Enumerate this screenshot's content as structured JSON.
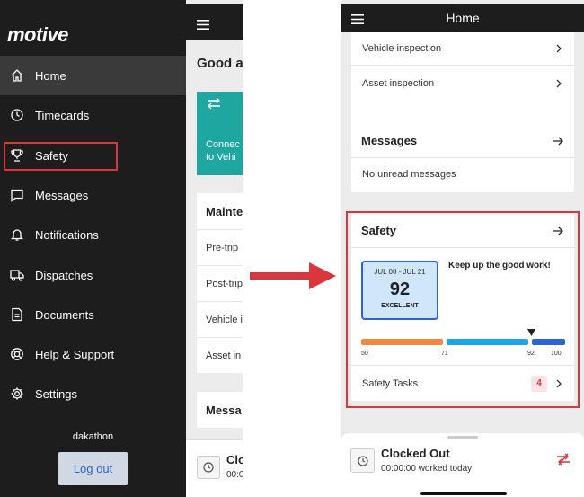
{
  "left": {
    "logo": "motive",
    "nav": [
      {
        "label": "Home",
        "icon": "home-icon"
      },
      {
        "label": "Timecards",
        "icon": "clock-icon"
      },
      {
        "label": "Safety",
        "icon": "trophy-icon"
      },
      {
        "label": "Messages",
        "icon": "chat-icon"
      },
      {
        "label": "Notifications",
        "icon": "bell-icon"
      },
      {
        "label": "Dispatches",
        "icon": "truck-icon"
      },
      {
        "label": "Documents",
        "icon": "document-icon"
      },
      {
        "label": "Help & Support",
        "icon": "lifebuoy-icon"
      },
      {
        "label": "Settings",
        "icon": "gear-icon"
      }
    ],
    "username": "dakathon",
    "logout": "Log out",
    "behind": {
      "greeting": "Good a",
      "teal_line1": "Connec",
      "teal_line2": "to Vehi",
      "maint_header": "Mainte",
      "maint_rows": [
        "Pre-trip",
        "Post-trip",
        "Vehicle i",
        "Asset in"
      ],
      "messages_header": "Messa",
      "clocked": "Clock",
      "clocked_sub": "00:0"
    }
  },
  "right": {
    "title": "Home",
    "inspections": [
      "Vehicle inspection",
      "Asset inspection"
    ],
    "messages": {
      "header": "Messages",
      "empty": "No unread messages"
    },
    "safety": {
      "header": "Safety",
      "dates": "JUL 08 - JUL 21",
      "score": "92",
      "rating": "EXCELLENT",
      "message": "Keep up the good work!",
      "ticks": [
        "50",
        "71",
        "92",
        "100"
      ],
      "tasks_label": "Safety Tasks",
      "tasks_count": "4"
    },
    "status": {
      "title": "Clocked Out",
      "sub": "00:00:00 worked today"
    }
  },
  "colors": {
    "drawer_bg": "#1d1d1d",
    "teal": "#1ea7a0",
    "highlight_red": "#d9363e",
    "bar_orange": "#f0883e",
    "bar_lightblue": "#1aa6e8",
    "bar_blue": "#2b63d9"
  }
}
